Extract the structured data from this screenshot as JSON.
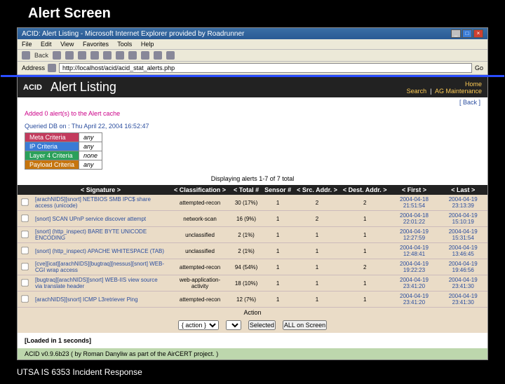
{
  "slide": {
    "title": "Alert Screen",
    "footer": "UTSA IS 6353 Incident Response"
  },
  "browser": {
    "title": "ACID: Alert Listing - Microsoft Internet Explorer provided by Roadrunner",
    "menu": {
      "file": "File",
      "edit": "Edit",
      "view": "View",
      "fav": "Favorites",
      "tools": "Tools",
      "help": "Help"
    },
    "toolbar": {
      "back": "Back"
    },
    "address_label": "Address",
    "address": "http://localhost/acid/acid_stat_alerts.php",
    "go": "Go"
  },
  "acid": {
    "logo": "ACID",
    "page_title": "Alert Listing",
    "nav": {
      "home": "Home",
      "search": "Search",
      "maint": "AG Maintenance"
    },
    "back": "[ Back ]",
    "added": "Added 0 alert(s) to the Alert cache",
    "queried": "Queried DB on : Thu April 22, 2004 16:52:47",
    "criteria_rows": [
      {
        "cls": "crit-meta",
        "k": "Meta Criteria",
        "v": "any"
      },
      {
        "cls": "crit-ip",
        "k": "IP Criteria",
        "v": "any"
      },
      {
        "cls": "crit-l4",
        "k": "Layer 4 Criteria",
        "v": "none"
      },
      {
        "cls": "crit-pay",
        "k": "Payload Criteria",
        "v": "any"
      }
    ],
    "displaying": "Displaying alerts 1-7 of 7 total",
    "columns": {
      "sig": "< Signature >",
      "class": "< Classification >",
      "total": "< Total #",
      "sensor": "Sensor #",
      "src": "< Src. Addr. >",
      "dst": "< Dest. Addr. >",
      "first": "< First >",
      "last": "< Last >"
    },
    "rows": [
      {
        "sig": "[arachNIDS][snort] NETBIOS SMB IPC$ share access (unicode)",
        "cls": "attempted-recon",
        "total": "30 (17%)",
        "sensor": "1",
        "src": "2",
        "dst": "2",
        "first": "2004-04-18 21:51:54",
        "last": "2004-04-19 23:13:39"
      },
      {
        "sig": "[snort] SCAN UPnP service discover attempt",
        "cls": "network-scan",
        "total": "16 (9%)",
        "sensor": "1",
        "src": "2",
        "dst": "1",
        "first": "2004-04-18 22:01:22",
        "last": "2004-04-19 15:10:19"
      },
      {
        "sig": "[snort] (http_inspect) BARE BYTE UNICODE ENCODING",
        "cls": "unclassified",
        "total": "2 (1%)",
        "sensor": "1",
        "src": "1",
        "dst": "1",
        "first": "2004-04-19 12:27:59",
        "last": "2004-04-19 15:31:54"
      },
      {
        "sig": "[snort] (http_inspect) APACHE WHITESPACE (TAB)",
        "cls": "unclassified",
        "total": "2 (1%)",
        "sensor": "1",
        "src": "1",
        "dst": "1",
        "first": "2004-04-19 12:48:41",
        "last": "2004-04-19 13:46:45"
      },
      {
        "sig": "[cve][icat][arachNIDS][bugtraq][nessus][snort] WEB-CGI wrap access",
        "cls": "attempted-recon",
        "total": "94 (54%)",
        "sensor": "1",
        "src": "1",
        "dst": "2",
        "first": "2004-04-19 19:22:23",
        "last": "2004-04-19 19:46:56"
      },
      {
        "sig": "[bugtraq][arachNIDS][snort] WEB-IIS view source via translate header",
        "cls": "web-application-activity",
        "total": "18 (10%)",
        "sensor": "1",
        "src": "1",
        "dst": "1",
        "first": "2004-04-19 23:41:20",
        "last": "2004-04-19 23:41:30"
      },
      {
        "sig": "[arachNIDS][snort] ICMP L3retriever Ping",
        "cls": "attempted-recon",
        "total": "12 (7%)",
        "sensor": "1",
        "src": "1",
        "dst": "1",
        "first": "2004-04-19 23:41:20",
        "last": "2004-04-19 23:41:30"
      }
    ],
    "action_hdr": "Action",
    "action_placeholder": "{ action }",
    "selected_btn": "Selected",
    "all_btn": "ALL on Screen",
    "loaded": "[Loaded in 1 seconds]",
    "footer": "ACID v0.9.6b23 ( by Roman Danyliw as part of the AirCERT project. )"
  }
}
